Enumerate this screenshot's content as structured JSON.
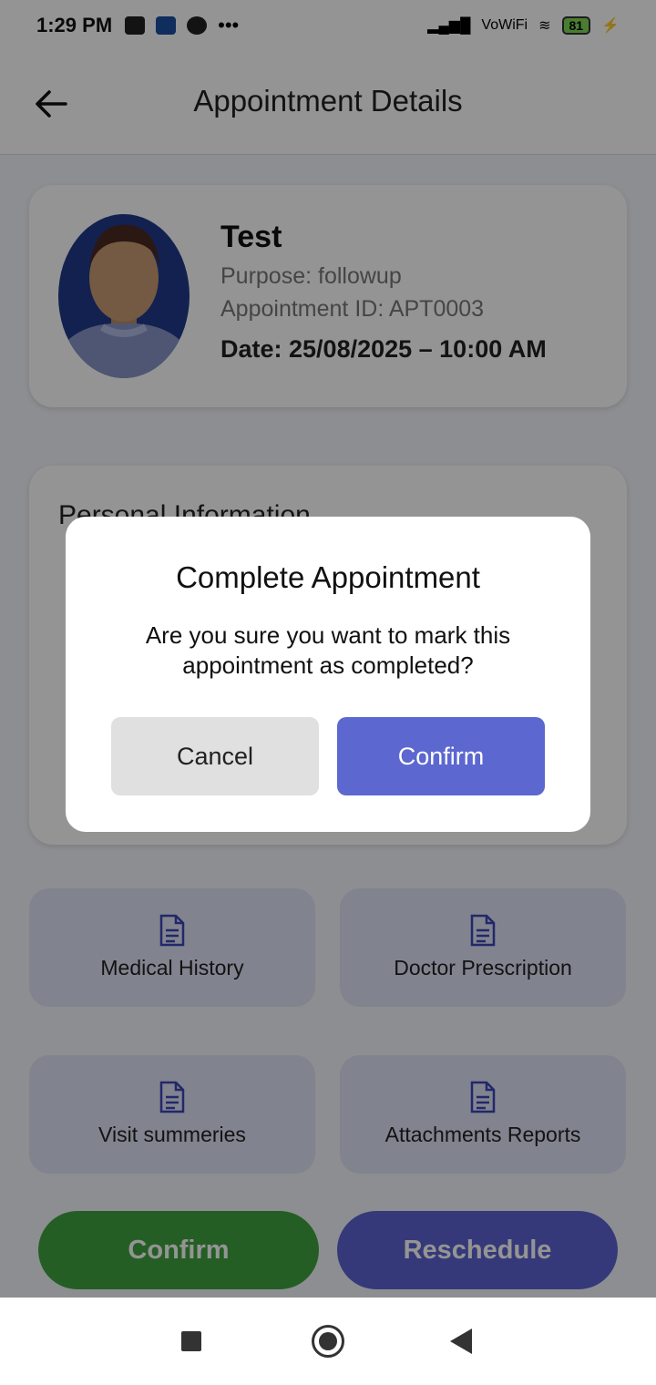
{
  "status_bar": {
    "time": "1:29 PM",
    "battery": "81"
  },
  "header": {
    "title": "Appointment Details"
  },
  "patient": {
    "name": "Test",
    "purpose": "Purpose: followup",
    "appointment_id": "Appointment ID: APT0003",
    "date": "Date: 25/08/2025 – 10:00 AM"
  },
  "personal_info": {
    "title": "Personal Information"
  },
  "tiles": [
    {
      "label": "Medical History",
      "icon": "document-icon"
    },
    {
      "label": "Doctor Prescription",
      "icon": "document-icon"
    },
    {
      "label": "Visit summeries",
      "icon": "document-icon"
    },
    {
      "label": "Attachments Reports",
      "icon": "document-icon"
    }
  ],
  "actions": {
    "confirm": "Confirm",
    "reschedule": "Reschedule"
  },
  "dialog": {
    "title": "Complete Appointment",
    "message": "Are you sure you want to mark this appointment as completed?",
    "cancel": "Cancel",
    "confirm": "Confirm"
  },
  "colors": {
    "accent": "#5c67d0",
    "confirm_green": "#3fa33f",
    "tile_bg": "#dfe2f7"
  }
}
